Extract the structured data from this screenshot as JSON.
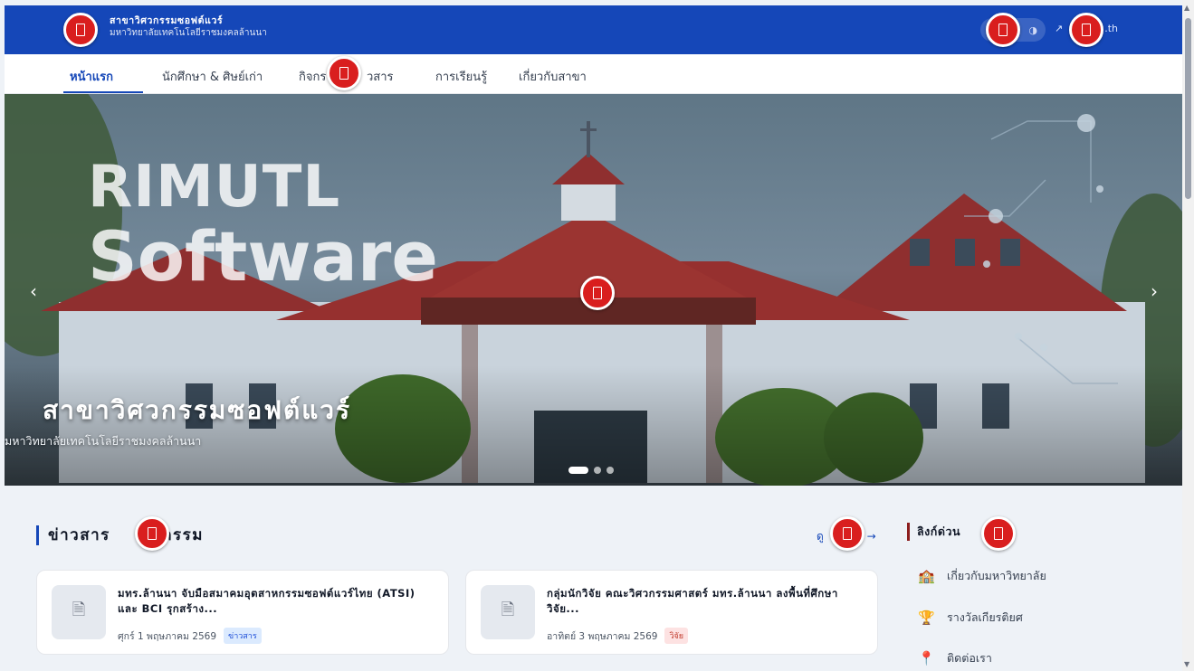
{
  "header": {
    "title": "สาขาวิศวกรรมซอฟต์แวร์",
    "subtitle": "มหาวิทยาลัยเทคโนโลยีราชมงคลล้านนา",
    "link_text": ".th",
    "link_icon": "external-link-icon"
  },
  "nav": {
    "items": [
      {
        "label": "หน้าแรก"
      },
      {
        "label": "นักศึกษา & ศิษย์เก่า"
      },
      {
        "label": "กิจกร"
      },
      {
        "label": "วสาร"
      },
      {
        "label": "การเรียนรู้"
      },
      {
        "label": "เกี่ยวกับสาขา"
      }
    ]
  },
  "hero": {
    "big_line1": "RIMUTL",
    "big_line2": "Software",
    "title": "สาขาวิศวกรรมซอฟต์แวร์",
    "subtitle": "มหาวิทยาลัยเทคโนโลยีราชมงคลล้านนา",
    "prev_icon": "‹",
    "next_icon": "›",
    "active_slide": 1,
    "slide_count": 3
  },
  "news": {
    "heading_start": "ข่าวสาร",
    "heading_end": "จกรรม",
    "see_all": "ดู",
    "see_all_arrow": "→",
    "items": [
      {
        "title": "มทร.ล้านนา จับมือสมาคมอุตสาหกรรมซอฟต์แวร์ไทย (ATSI) และ BCI รุกสร้าง...",
        "date": "ศุกร์ 1 พฤษภาคม 2569",
        "tag": "ข่าวสาร"
      },
      {
        "title": "กลุ่มนักวิจัย คณะวิศวกรรมศาสตร์ มทร.ล้านนา ลงพื้นที่ศึกษาวิจัย...",
        "date": "อาทิตย์ 3 พฤษภาคม 2569",
        "tag": "วิจัย"
      }
    ]
  },
  "quick_links": {
    "heading": "ลิงก์ด่วน",
    "items": [
      {
        "label": "เกี่ยวกับมหาวิทยาลัย",
        "icon": "🏫"
      },
      {
        "label": "รางวัลเกียรติยศ",
        "icon": "🏆"
      },
      {
        "label": "ติดต่อเรา",
        "icon": "📍"
      }
    ]
  },
  "colors": {
    "primary": "#1547b8",
    "marker": "#d91e1e"
  }
}
